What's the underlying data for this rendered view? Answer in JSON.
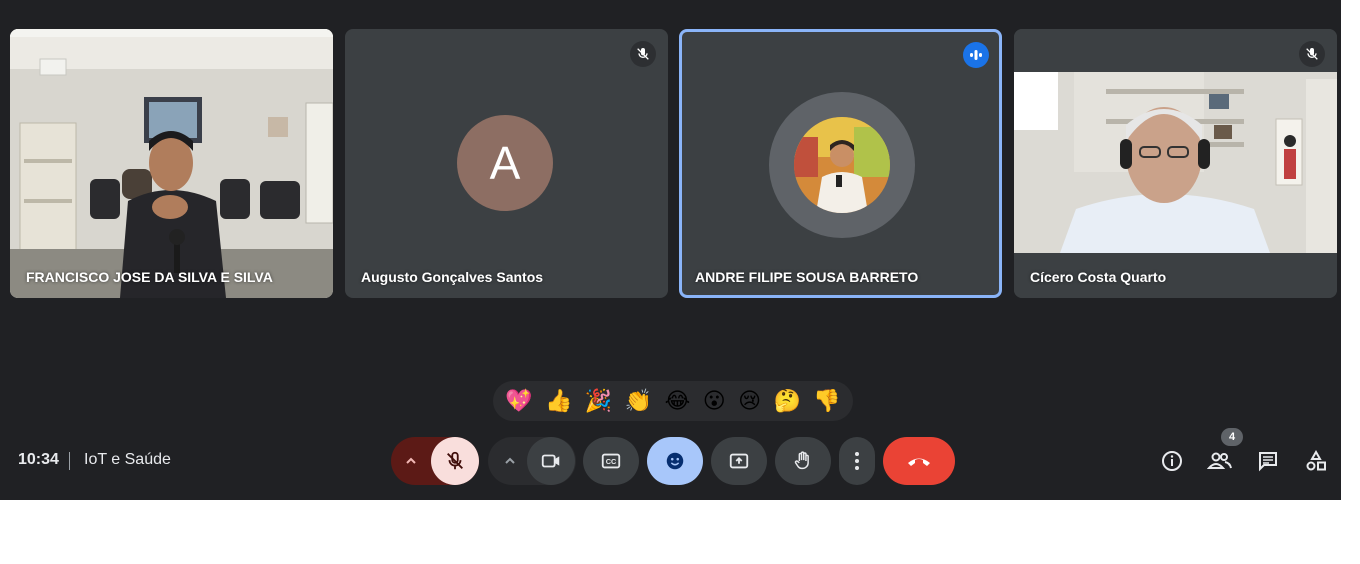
{
  "participants": [
    {
      "name": "FRANCISCO JOSE DA SILVA E SILVA",
      "state": "video"
    },
    {
      "name": "Augusto Gonçalves Santos",
      "initial": "A",
      "state": "muted"
    },
    {
      "name": "ANDRE FILIPE SOUSA BARRETO",
      "state": "speaking"
    },
    {
      "name": "Cícero Costa Quarto",
      "state": "muted"
    }
  ],
  "reactions": [
    "💖",
    "👍",
    "🎉",
    "👏",
    "😂",
    "😮",
    "😢",
    "🤔",
    "👎"
  ],
  "meeting": {
    "time": "10:34",
    "title": "IoT e Saúde"
  },
  "people_count": "4",
  "icons": {
    "mute": "mic-off-icon",
    "speaking": "audio-level-icon",
    "camera": "videocam-icon",
    "captions": "closed-caption-icon",
    "reactions": "emoji-icon",
    "present": "present-screen-icon",
    "hand": "raise-hand-icon",
    "more": "more-vertical-icon",
    "leave": "call-end-icon",
    "info": "info-icon",
    "people": "people-icon",
    "chat": "chat-icon",
    "activities": "activities-icon"
  },
  "colors": {
    "background": "#202124",
    "tile": "#3c4043",
    "active_border": "#8ab4f8",
    "leave": "#ea4335",
    "mic_off": "#f9dedc",
    "reaction_active": "#a8c7fa"
  }
}
